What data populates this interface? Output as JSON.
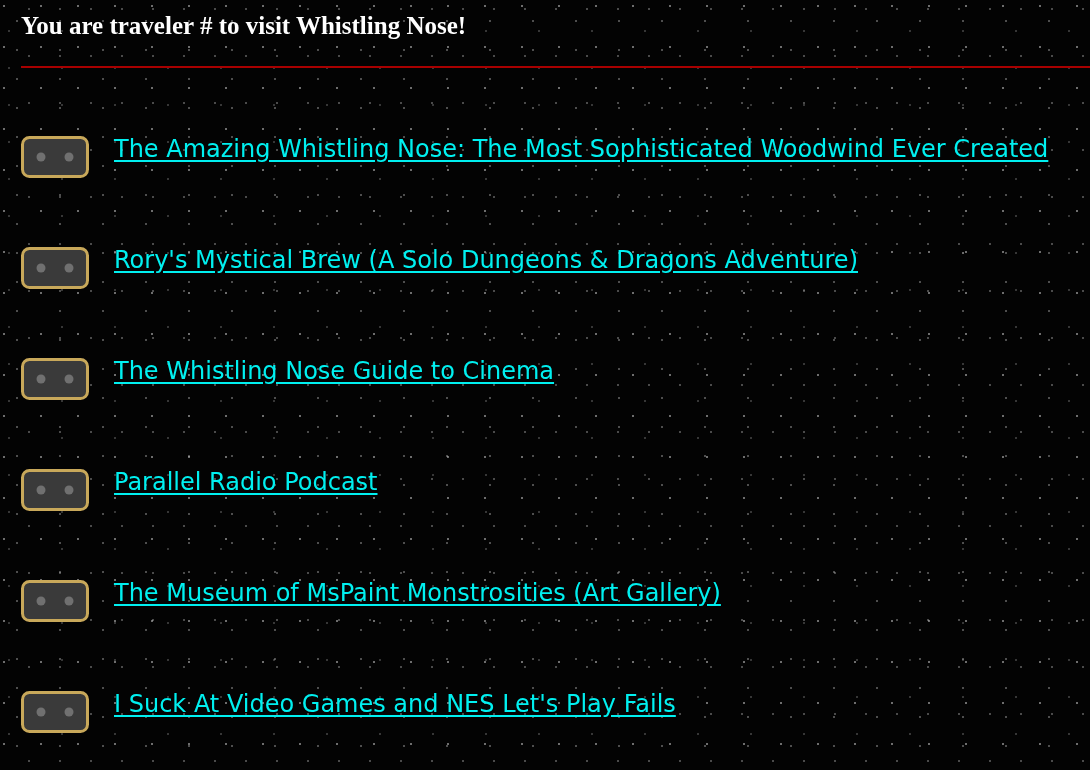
{
  "header": {
    "title": "You are traveler # to visit Whistling Nose!"
  },
  "links": [
    {
      "label": "The Amazing Whistling Nose: The Most Sophisticated Woodwind Ever Created"
    },
    {
      "label": "Rory's Mystical Brew (A Solo Dungeons & Dragons Adventure)"
    },
    {
      "label": "The Whistling Nose Guide to Cinema"
    },
    {
      "label": "Parallel Radio Podcast"
    },
    {
      "label": "The Museum of MsPaint Monstrosities (Art Gallery)"
    },
    {
      "label": "I Suck At Video Games and NES Let's Play Fails"
    }
  ]
}
